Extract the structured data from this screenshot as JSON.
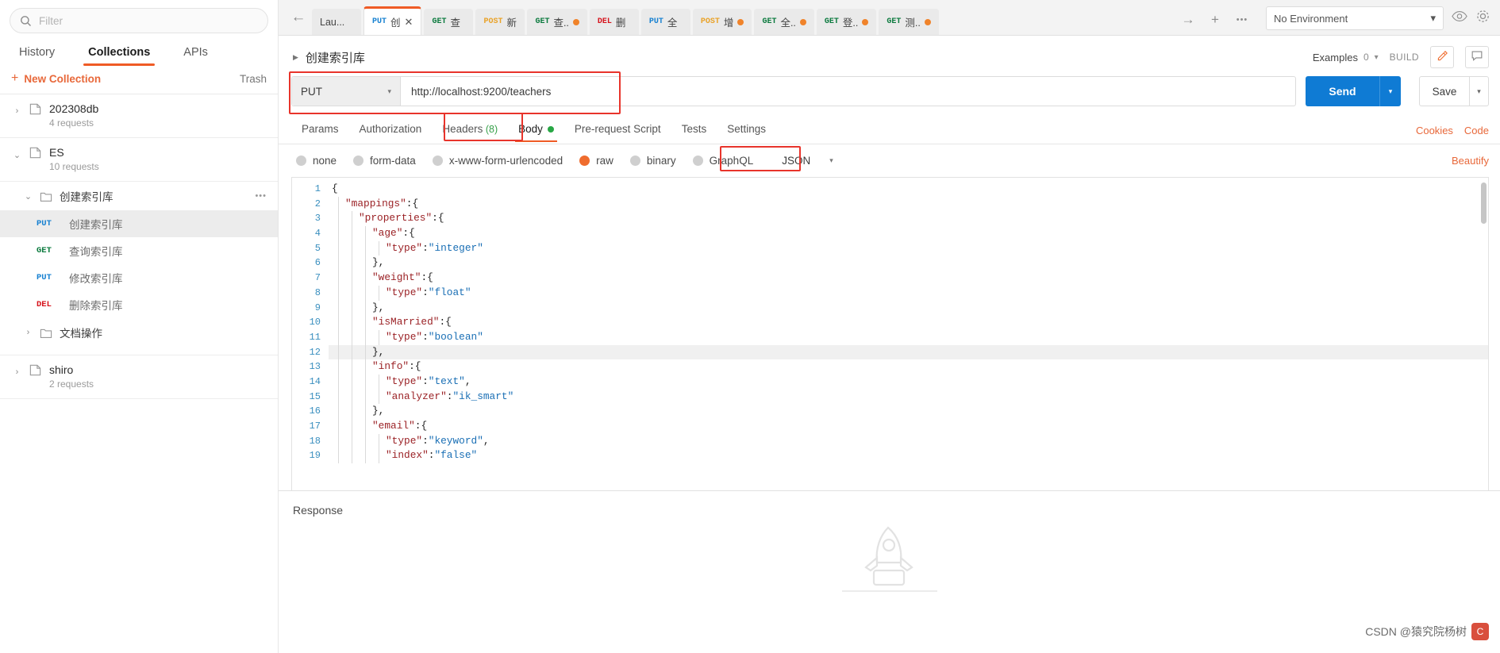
{
  "sidebar": {
    "filter": {
      "placeholder": "Filter",
      "value": "",
      "icon": "search-icon"
    },
    "tabs": [
      {
        "label": "History",
        "active": false
      },
      {
        "label": "Collections",
        "active": true
      },
      {
        "label": "APIs",
        "active": false
      }
    ],
    "new_collection": "New Collection",
    "plus": "+",
    "trash": "Trash",
    "collections": [
      {
        "name": "202308db",
        "requests": "4 requests",
        "expanded": false,
        "chevron": "›"
      },
      {
        "name": "ES",
        "requests": "10 requests",
        "expanded": true,
        "chevron": "⌄"
      }
    ],
    "folder": {
      "name": "创建索引库",
      "chevron": "⌄",
      "dots": "•••"
    },
    "requests": [
      {
        "verb": "PUT",
        "name": "创建索引库",
        "selected": true
      },
      {
        "verb": "GET",
        "name": "查询索引库",
        "selected": false
      },
      {
        "verb": "PUT",
        "name": "修改索引库",
        "selected": false
      },
      {
        "verb": "DEL",
        "name": "删除索引库",
        "selected": false
      }
    ],
    "folder2": {
      "name": "文档操作",
      "chevron": "›"
    },
    "collection3": {
      "name": "shiro",
      "requests": "2 requests",
      "chevron": "›"
    }
  },
  "tabbar": {
    "back": "←",
    "forward": "→",
    "plus": "+",
    "more": "•••",
    "tabs": [
      {
        "verb": "",
        "title": "Lau...",
        "dot": false,
        "close": false,
        "active": false
      },
      {
        "verb": "PUT",
        "title": "创",
        "dot": false,
        "close": true,
        "active": true
      },
      {
        "verb": "GET",
        "title": "查",
        "dot": false,
        "close": false,
        "active": false
      },
      {
        "verb": "POST",
        "title": "新",
        "dot": false,
        "close": false,
        "active": false
      },
      {
        "verb": "GET",
        "title": "查..",
        "dot": true,
        "close": false,
        "active": false
      },
      {
        "verb": "DEL",
        "title": "删",
        "dot": false,
        "close": false,
        "active": false
      },
      {
        "verb": "PUT",
        "title": "全",
        "dot": false,
        "close": false,
        "active": false
      },
      {
        "verb": "POST",
        "title": "增",
        "dot": true,
        "close": false,
        "active": false
      },
      {
        "verb": "GET",
        "title": "全..",
        "dot": true,
        "close": false,
        "active": false
      },
      {
        "verb": "GET",
        "title": "登..",
        "dot": true,
        "close": false,
        "active": false
      },
      {
        "verb": "GET",
        "title": "测..",
        "dot": true,
        "close": false,
        "active": false
      }
    ]
  },
  "environment": {
    "selected": "No Environment",
    "chevron": "▾",
    "eye_icon": "eye-icon",
    "settings_icon": "gear-icon"
  },
  "request": {
    "title": "创建索引库",
    "triangle": "▶",
    "examples_label": "Examples",
    "examples_count": "0",
    "examples_chevron": "▾",
    "build_label": "BUILD",
    "edit_icon": "pencil-icon",
    "comment_icon": "comment-icon",
    "method": "PUT",
    "method_chevron": "▾",
    "url": "http://localhost:9200/teachers",
    "send_label": "Send",
    "send_caret": "▾",
    "save_label": "Save",
    "save_caret": "▾"
  },
  "request_tabs": [
    {
      "label": "Params",
      "active": false
    },
    {
      "label": "Authorization",
      "active": false
    },
    {
      "label": "Headers",
      "count": "(8)",
      "active": false
    },
    {
      "label": "Body",
      "dot": true,
      "active": true
    },
    {
      "label": "Pre-request Script",
      "active": false
    },
    {
      "label": "Tests",
      "active": false
    },
    {
      "label": "Settings",
      "active": false
    }
  ],
  "links": {
    "cookies": "Cookies",
    "code": "Code",
    "beautify": "Beautify"
  },
  "body_types": [
    {
      "label": "none",
      "selected": false
    },
    {
      "label": "form-data",
      "selected": false
    },
    {
      "label": "x-www-form-urlencoded",
      "selected": false
    },
    {
      "label": "raw",
      "selected": true
    },
    {
      "label": "binary",
      "selected": false
    },
    {
      "label": "GraphQL",
      "selected": false
    }
  ],
  "body_format": {
    "value": "JSON",
    "chevron": "▾"
  },
  "editor": {
    "active_line": 12,
    "lines": [
      {
        "n": 1,
        "indent": 0,
        "tokens": [
          {
            "t": "p",
            "v": "{"
          }
        ]
      },
      {
        "n": 2,
        "indent": 1,
        "tokens": [
          {
            "t": "k",
            "v": "\"mappings\""
          },
          {
            "t": "p",
            "v": ":{"
          }
        ]
      },
      {
        "n": 3,
        "indent": 2,
        "tokens": [
          {
            "t": "k",
            "v": "\"properties\""
          },
          {
            "t": "p",
            "v": ":{"
          }
        ]
      },
      {
        "n": 4,
        "indent": 3,
        "tokens": [
          {
            "t": "k",
            "v": "\"age\""
          },
          {
            "t": "p",
            "v": ":{"
          }
        ]
      },
      {
        "n": 5,
        "indent": 4,
        "tokens": [
          {
            "t": "k",
            "v": "\"type\""
          },
          {
            "t": "p",
            "v": ":"
          },
          {
            "t": "s",
            "v": "\"integer\""
          }
        ]
      },
      {
        "n": 6,
        "indent": 3,
        "tokens": [
          {
            "t": "p",
            "v": "},"
          }
        ]
      },
      {
        "n": 7,
        "indent": 3,
        "tokens": [
          {
            "t": "k",
            "v": "\"weight\""
          },
          {
            "t": "p",
            "v": ":{"
          }
        ]
      },
      {
        "n": 8,
        "indent": 4,
        "tokens": [
          {
            "t": "k",
            "v": "\"type\""
          },
          {
            "t": "p",
            "v": ":"
          },
          {
            "t": "s",
            "v": "\"float\""
          }
        ]
      },
      {
        "n": 9,
        "indent": 3,
        "tokens": [
          {
            "t": "p",
            "v": "},"
          }
        ]
      },
      {
        "n": 10,
        "indent": 3,
        "tokens": [
          {
            "t": "k",
            "v": "\"isMarried\""
          },
          {
            "t": "p",
            "v": ":{"
          }
        ]
      },
      {
        "n": 11,
        "indent": 4,
        "tokens": [
          {
            "t": "k",
            "v": "\"type\""
          },
          {
            "t": "p",
            "v": ":"
          },
          {
            "t": "s",
            "v": "\"boolean\""
          }
        ]
      },
      {
        "n": 12,
        "indent": 3,
        "tokens": [
          {
            "t": "p",
            "v": "},"
          }
        ]
      },
      {
        "n": 13,
        "indent": 3,
        "tokens": [
          {
            "t": "k",
            "v": "\"info\""
          },
          {
            "t": "p",
            "v": ":{"
          }
        ]
      },
      {
        "n": 14,
        "indent": 4,
        "tokens": [
          {
            "t": "k",
            "v": "\"type\""
          },
          {
            "t": "p",
            "v": ":"
          },
          {
            "t": "s",
            "v": "\"text\""
          },
          {
            "t": "p",
            "v": ","
          }
        ]
      },
      {
        "n": 15,
        "indent": 4,
        "tokens": [
          {
            "t": "k",
            "v": "\"analyzer\""
          },
          {
            "t": "p",
            "v": ":"
          },
          {
            "t": "s",
            "v": "\"ik_smart\""
          }
        ]
      },
      {
        "n": 16,
        "indent": 3,
        "tokens": [
          {
            "t": "p",
            "v": "},"
          }
        ]
      },
      {
        "n": 17,
        "indent": 3,
        "tokens": [
          {
            "t": "k",
            "v": "\"email\""
          },
          {
            "t": "p",
            "v": ":{"
          }
        ]
      },
      {
        "n": 18,
        "indent": 4,
        "tokens": [
          {
            "t": "k",
            "v": "\"type\""
          },
          {
            "t": "p",
            "v": ":"
          },
          {
            "t": "s",
            "v": "\"keyword\""
          },
          {
            "t": "p",
            "v": ","
          }
        ]
      },
      {
        "n": 19,
        "indent": 4,
        "tokens": [
          {
            "t": "k",
            "v": "\"index\""
          },
          {
            "t": "p",
            "v": ":"
          },
          {
            "t": "s",
            "v": "\"false\""
          }
        ]
      }
    ]
  },
  "response": {
    "label": "Response"
  },
  "watermark": {
    "text": "CSDN @猿究院杨树",
    "badge": "C"
  },
  "colors": {
    "accent": "#ef5b25",
    "send": "#0f7bd4",
    "highlight_box": "#e8342b",
    "get": "#0b7a3e",
    "put": "#1781d1",
    "del": "#d6121b",
    "post": "#e9a228"
  }
}
